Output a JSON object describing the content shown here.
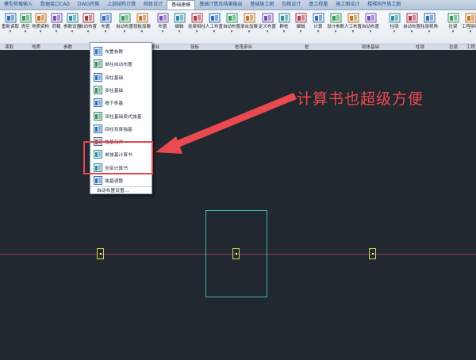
{
  "tabs": [
    {
      "label": "模型荷载输入",
      "active": false
    },
    {
      "label": "数据接口CAD",
      "active": false
    },
    {
      "label": "DWG转换",
      "active": false
    },
    {
      "label": "上部结构计算",
      "active": false
    },
    {
      "label": "砌体设计",
      "active": false
    },
    {
      "label": "基础建模",
      "active": true
    },
    {
      "label": "基础计算及结果输出",
      "active": false
    },
    {
      "label": "基础施工图",
      "active": false
    },
    {
      "label": "包络设计",
      "active": false
    },
    {
      "label": "基工程量",
      "active": false
    },
    {
      "label": "施工图设计",
      "active": false
    },
    {
      "label": "楼梯构件施工图",
      "active": false
    }
  ],
  "ribbon": {
    "buttons": [
      {
        "label": "重新读取",
        "icon": "reload-icon"
      },
      {
        "label": "清空",
        "icon": "clear-icon"
      },
      {
        "label": "地质资料",
        "icon": "geology-icon"
      },
      {
        "label": "荷载",
        "icon": "load-icon"
      },
      {
        "label": "参数设置",
        "icon": "settings-icon"
      },
      {
        "label": "自动布置",
        "icon": "auto-layout-icon"
      },
      {
        "label": "布置",
        "icon": "place-icon"
      },
      {
        "label": "自动布置",
        "icon": "auto-layout-icon"
      },
      {
        "label": "筏板加腋",
        "icon": "raft-icon"
      },
      {
        "label": "布置",
        "icon": "place-icon"
      },
      {
        "label": "编辑",
        "icon": "edit-icon"
      },
      {
        "label": "连梁相柱",
        "icon": "beam-icon"
      },
      {
        "label": "人工布置",
        "icon": "manual-icon"
      },
      {
        "label": "自动布置",
        "icon": "auto-layout-icon"
      },
      {
        "label": "承台加腋",
        "icon": "cap-icon"
      },
      {
        "label": "定义布置",
        "icon": "define-icon"
      },
      {
        "label": "群桩",
        "icon": "pile-group-icon"
      },
      {
        "label": "编辑",
        "icon": "edit-icon"
      },
      {
        "label": "计算",
        "icon": "calc-icon"
      },
      {
        "label": "设计参数",
        "icon": "param-icon"
      },
      {
        "label": "人工布置",
        "icon": "manual-icon"
      },
      {
        "label": "自动布置",
        "icon": "auto-layout-icon"
      },
      {
        "label": "柱墩",
        "icon": "pier-icon"
      },
      {
        "label": "自动布置",
        "icon": "auto-layout-icon"
      },
      {
        "label": "柱墩视角",
        "icon": "pier-view-icon"
      },
      {
        "label": "拉梁",
        "icon": "tie-beam-icon"
      },
      {
        "label": "工程拼装",
        "icon": "assemble-icon"
      }
    ],
    "groups": [
      "读取",
      "地质",
      "参数",
      "承台",
      "筏板",
      "桩筏承台",
      "桩",
      "砌体基础",
      "柱墩",
      "拉梁",
      "工程"
    ]
  },
  "dropdown": {
    "items": [
      {
        "label": "布置参数",
        "icon": "params-icon"
      },
      {
        "label": "单柱自动布置",
        "icon": "single-column-icon"
      },
      {
        "label": "双柱基础",
        "icon": "double-column-icon"
      },
      {
        "label": "多柱基础",
        "icon": "multi-column-icon"
      },
      {
        "label": "墙下条基",
        "icon": "wall-strip-icon"
      },
      {
        "label": "双柱基础梁式独基",
        "icon": "beam-footing-icon"
      },
      {
        "label": "四柱双梁独基",
        "icon": "four-column-icon"
      },
      {
        "label": "独基归并",
        "icon": "merge-icon"
      },
      {
        "label": "单独基计算书",
        "icon": "report-icon"
      },
      {
        "label": "全部计算书",
        "icon": "report-all-icon"
      },
      {
        "label": "独基调整",
        "icon": "adjust-icon"
      }
    ],
    "footer": "自动布置设置..."
  },
  "annotation": {
    "callout": "计算书也超级方便",
    "color": "#f0484f"
  },
  "colors": {
    "canvas": "#212830",
    "axis": "#a23a52",
    "foundation": "#3fb7a4",
    "column": "#d9d54a"
  }
}
